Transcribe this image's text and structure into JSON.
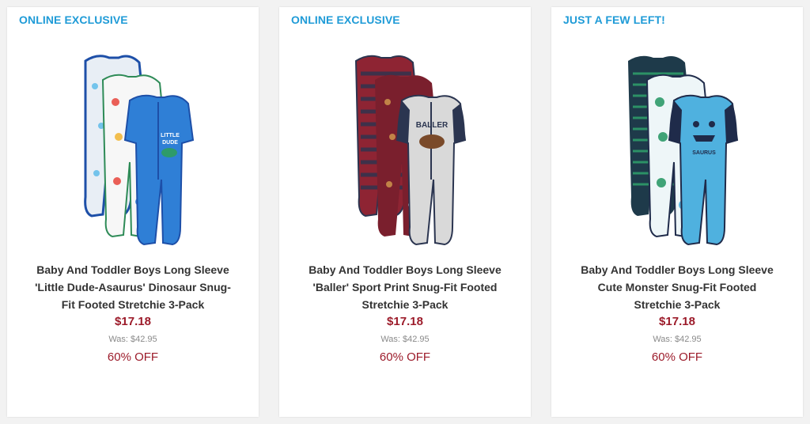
{
  "products": [
    {
      "badge": "ONLINE EXCLUSIVE",
      "name": "Baby And Toddler Boys Long Sleeve 'Little Dude-Asaurus' Dinosaur Snug-Fit Footed Stretchie 3-Pack",
      "price": "$17.18",
      "was": "Was: $42.95",
      "discount": "60% OFF",
      "image_colors": {
        "back": "#e8eef5",
        "middle": "#f7f7f7",
        "front": "#2f7fd6",
        "trim": "#1d4fa8",
        "accent": "#4cb5e8"
      },
      "front_print": "LITTLE DUDE"
    },
    {
      "badge": "ONLINE EXCLUSIVE",
      "name": "Baby And Toddler Boys Long Sleeve 'Baller' Sport Print Snug-Fit Footed Stretchie 3-Pack",
      "price": "$17.18",
      "was": "Was: $42.95",
      "discount": "60% OFF",
      "image_colors": {
        "back": "#8e2433",
        "middle": "#7a1f2d",
        "front": "#d9d9d9",
        "trim": "#2b3550",
        "accent": "#c98e4a"
      },
      "front_print": "BALLER"
    },
    {
      "badge": "JUST A FEW LEFT!",
      "name": "Baby And Toddler Boys Long Sleeve Cute Monster Snug-Fit Footed Stretchie 3-Pack",
      "price": "$17.18",
      "was": "Was: $42.95",
      "discount": "60% OFF",
      "image_colors": {
        "back": "#1e3a4a",
        "middle": "#eef6f8",
        "front": "#4fb1df",
        "trim": "#1f2b4a",
        "accent": "#2e9b6a"
      },
      "front_print": "SAURUS"
    }
  ]
}
